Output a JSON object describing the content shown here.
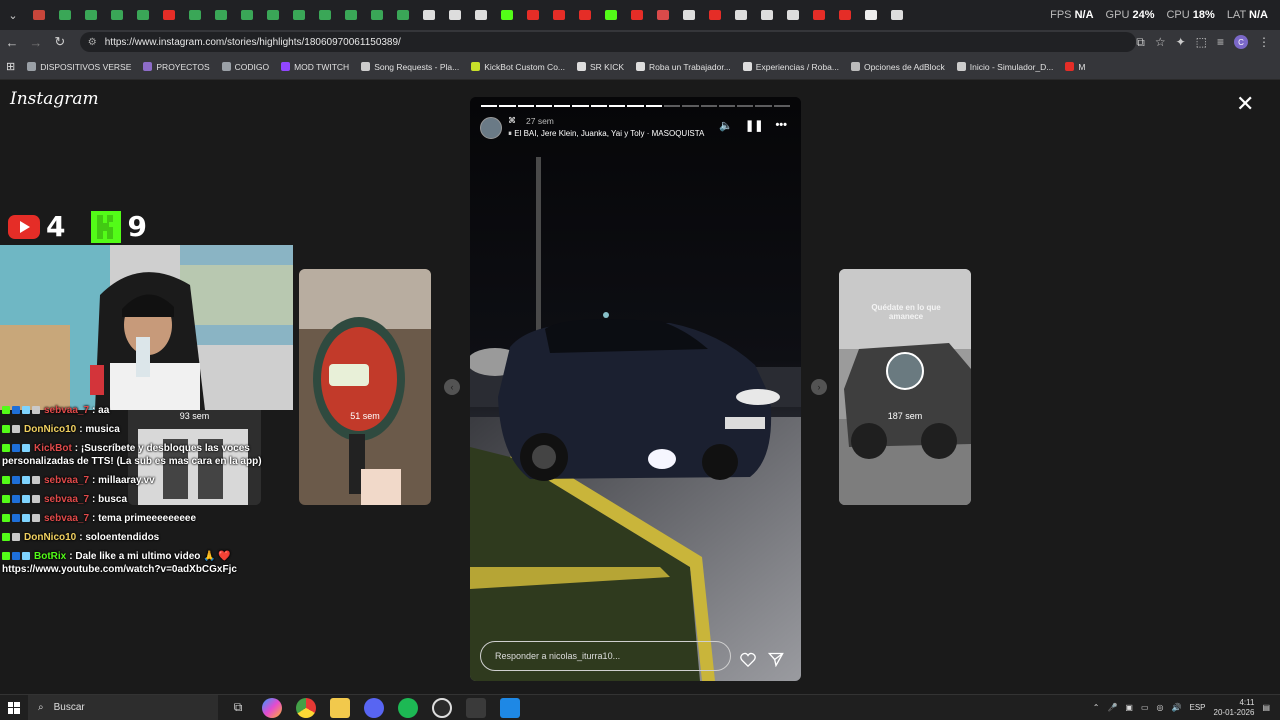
{
  "browser": {
    "url": "https://www.instagram.com/stories/highlights/18060970061150389/",
    "tabs": [
      "gmail",
      "drive",
      "drive",
      "drive",
      "drive",
      "youtube",
      "drive",
      "drive",
      "drive",
      "drive",
      "drive",
      "drive",
      "drive",
      "drive",
      "drive",
      "tiktok",
      "tiktok",
      "tiktok",
      "kick",
      "youtube",
      "youtube",
      "youtube",
      "kick",
      "youtube",
      "special",
      "tiktok",
      "youtube",
      "tiktok",
      "tiktok",
      "tiktok",
      "youtube",
      "youtube",
      "doc",
      "tiktok"
    ],
    "tab_colors": {
      "gmail": "#c7463b",
      "drive": "#3aa757",
      "youtube": "#e52d27",
      "tiktok": "#dddddd",
      "kick": "#53fc18",
      "special": "#d94a4a",
      "doc": "#eeeeee"
    },
    "hud": {
      "fps_label": "FPS",
      "fps_value": "N/A",
      "gpu_label": "GPU",
      "gpu_value": "24%",
      "cpu_label": "CPU",
      "cpu_value": "18%",
      "lat_label": "LAT",
      "lat_value": "N/A"
    },
    "profile_initial": "C",
    "bookmarks": [
      {
        "label": "DISPOSITIVOS VERSE",
        "color": "#9aa0a6"
      },
      {
        "label": "PROYECTOS",
        "color": "#8d6cc8"
      },
      {
        "label": "CODIGO",
        "color": "#9aa0a6"
      },
      {
        "label": "MOD TWITCH",
        "color": "#9146ff"
      },
      {
        "label": "Song Requests - Pla...",
        "color": "#cccccc"
      },
      {
        "label": "KickBot Custom Co...",
        "color": "#c8e02a"
      },
      {
        "label": "SR KICK",
        "color": "#dddddd"
      },
      {
        "label": "Roba un Trabajador...",
        "color": "#dddddd"
      },
      {
        "label": "Experiencias / Roba...",
        "color": "#dddddd"
      },
      {
        "label": "Opciones de AdBlock",
        "color": "#bbbbbb"
      },
      {
        "label": "Inicio - Simulador_D...",
        "color": "#cccccc"
      },
      {
        "label": "M",
        "color": "#e52d27"
      }
    ]
  },
  "instagram": {
    "logo": "Instagram",
    "story": {
      "time": "27 sem",
      "music": "El BAI, Jere Klein, Juanka, Yai y Toly · MASOQUISTA",
      "segments_total": 17,
      "segments_done": 10,
      "reply_placeholder": "Responder a nicolas_iturra10..."
    },
    "prev_card_label": "51 sem",
    "prev_far_card_label": "93 sem",
    "next_card_label": "187 sem",
    "next_card_caption": "Quédate en lo que amanece"
  },
  "overlay": {
    "youtube_count": "4",
    "kick_count": "9",
    "chat": [
      {
        "user": "sebvaa_7",
        "color": "#e04a4a",
        "msg": ": aa",
        "badges": [
          "k",
          "b",
          "v",
          "s"
        ]
      },
      {
        "user": "DonNico10",
        "color": "#f0d060",
        "msg": ": musica",
        "badges": [
          "k",
          "s"
        ]
      },
      {
        "user": "KickBot",
        "color": "#e04a4a",
        "msg": ": ¡Suscríbete y desbloques las voces personalizadas de TTS! (La sub es mas cara en la app)",
        "badges": [
          "k",
          "b",
          "v"
        ]
      },
      {
        "user": "sebvaa_7",
        "color": "#e04a4a",
        "msg": ": millaaray.vv",
        "badges": [
          "k",
          "b",
          "v",
          "s"
        ]
      },
      {
        "user": "sebvaa_7",
        "color": "#e04a4a",
        "msg": ": busca",
        "badges": [
          "k",
          "b",
          "v",
          "s"
        ]
      },
      {
        "user": "sebvaa_7",
        "color": "#e04a4a",
        "msg": ": tema primeeeeeeeee",
        "badges": [
          "k",
          "b",
          "v",
          "s"
        ]
      },
      {
        "user": "DonNico10",
        "color": "#f0d060",
        "msg": ": soloentendidos",
        "badges": [
          "k",
          "s"
        ]
      },
      {
        "user": "BotRix",
        "color": "#53fc18",
        "msg": ": Dale like a mi ultimo video 🙏 ❤️ https://www.youtube.com/watch?v=0adXbCGxFjc",
        "badges": [
          "k",
          "b",
          "v"
        ]
      }
    ]
  },
  "taskbar": {
    "search_label": "Buscar",
    "language": "ESP",
    "time": "4:11",
    "date": "20-01-2026"
  }
}
